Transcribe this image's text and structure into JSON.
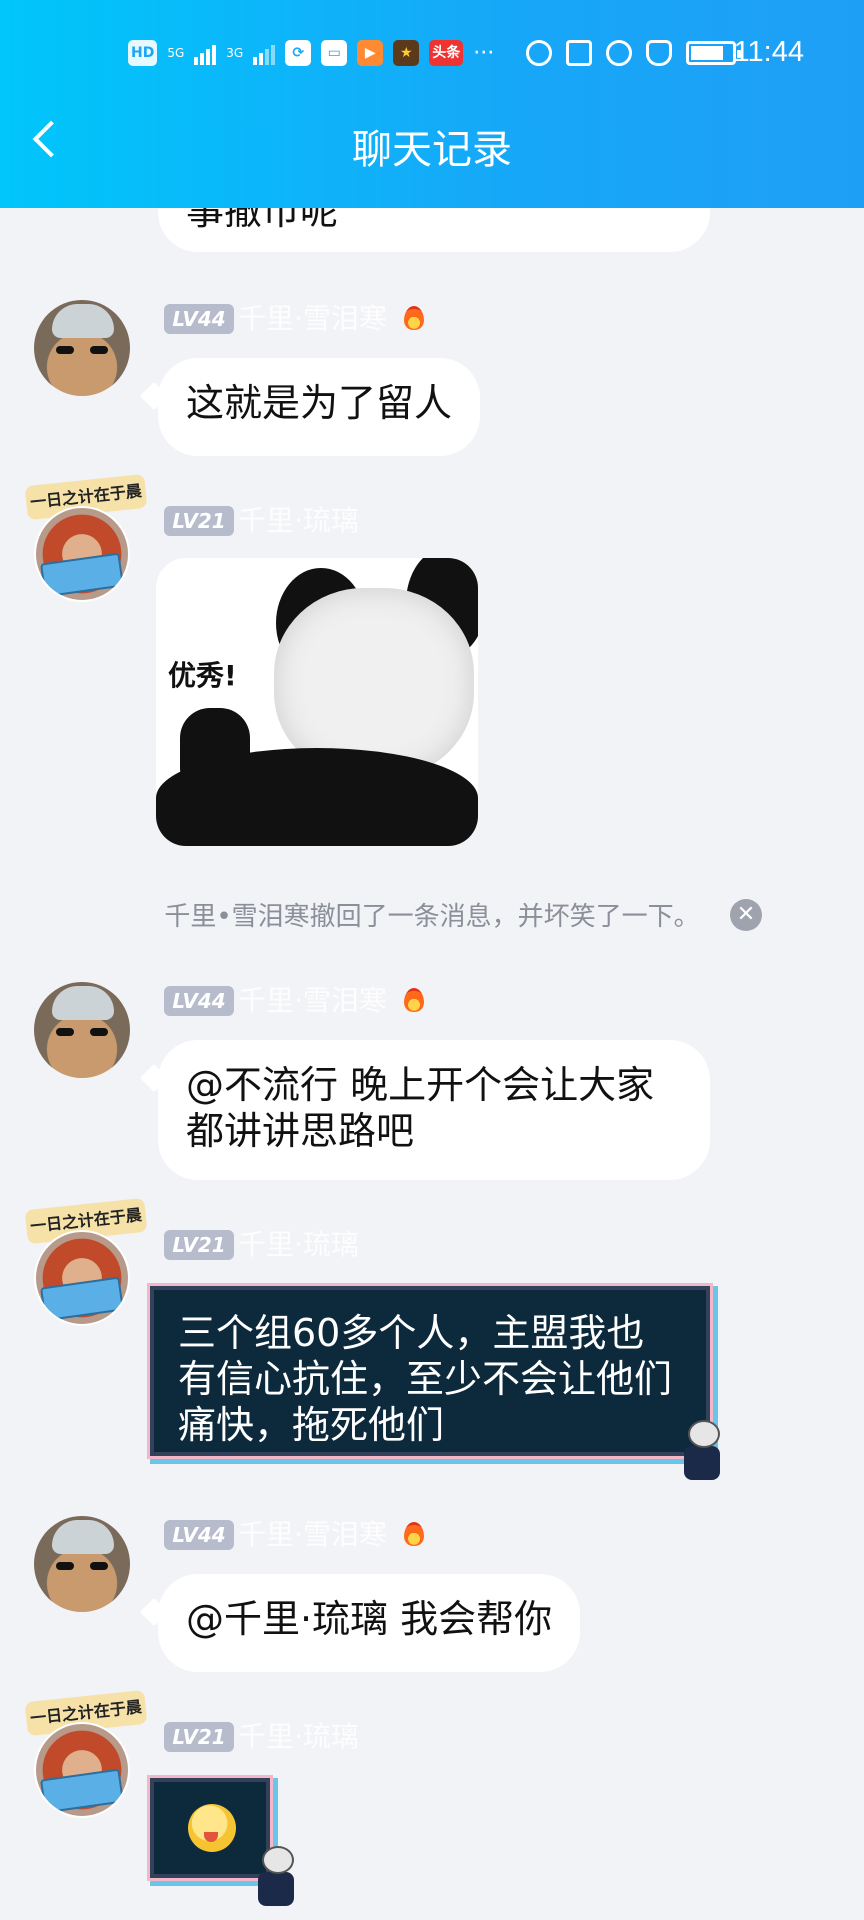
{
  "status_bar": {
    "time": "11:44",
    "left_icons": [
      "HD",
      "5G",
      "3G"
    ],
    "network_5g": "5G",
    "network_3g": "3G",
    "hd": "HD",
    "more": "···",
    "app_label": "头条"
  },
  "header": {
    "title": "聊天记录",
    "back_icon": "chevron-left-icon"
  },
  "messages": [
    {
      "id": "m0",
      "type": "text",
      "text": "事撤币呢"
    },
    {
      "id": "m1",
      "type": "text",
      "sender": "千里·雪泪寒",
      "level": "LV44",
      "text": "这就是为了留人",
      "flame": true
    },
    {
      "id": "m2",
      "type": "sticker",
      "sender": "千里·琉璃",
      "level": "LV21",
      "sticker_text": "优秀!",
      "avatar_badge": "一日之计在于晨"
    },
    {
      "id": "m3",
      "type": "system",
      "text": "千里•雪泪寒撤回了一条消息，并坏笑了一下。"
    },
    {
      "id": "m4",
      "type": "text",
      "sender": "千里·雪泪寒",
      "level": "LV44",
      "text": "@不流行 晚上开个会让大家都讲讲思路吧",
      "flame": true
    },
    {
      "id": "m5",
      "type": "fancy",
      "sender": "千里·琉璃",
      "level": "LV21",
      "text": "三个组60多个人，主盟我也有信心抗住，至少不会让他们痛快，拖死他们"
    },
    {
      "id": "m6",
      "type": "text",
      "sender": "千里·雪泪寒",
      "level": "LV44",
      "text": "@千里·琉璃 我会帮你",
      "flame": true
    },
    {
      "id": "m7",
      "type": "fancy-emoji",
      "sender": "千里·琉璃",
      "level": "LV21",
      "emoji": "tongue-out-emoji"
    }
  ]
}
